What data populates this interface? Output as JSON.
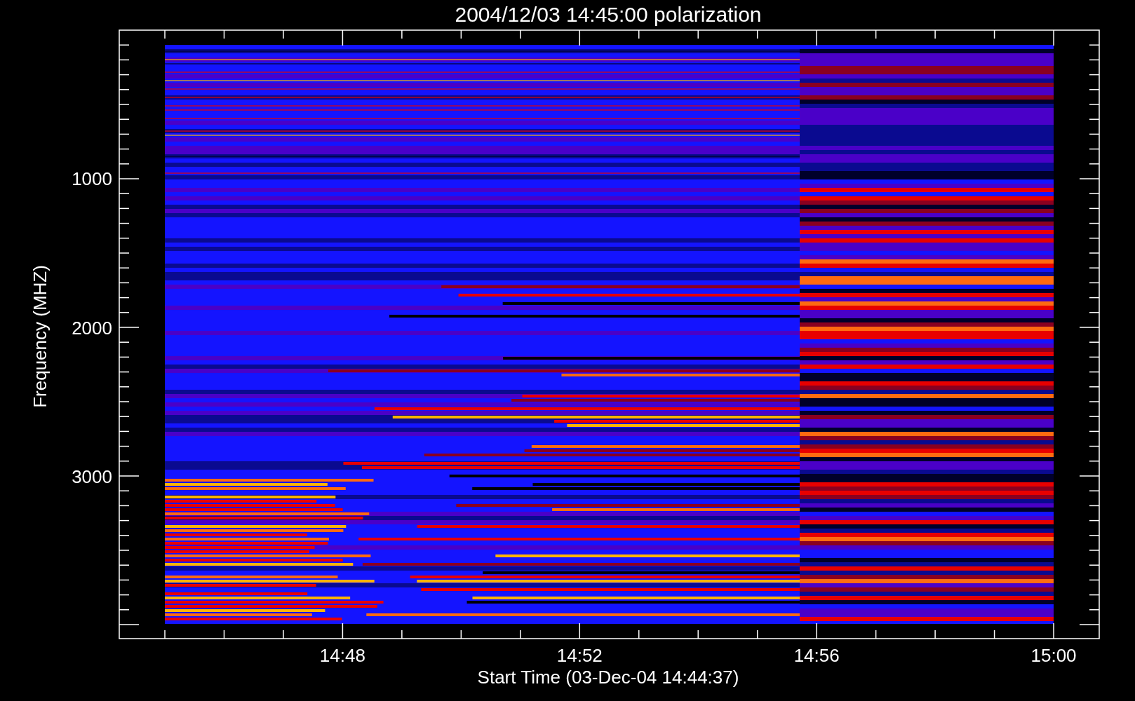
{
  "title": "2004/12/03 14:45:00 polarization",
  "y_axis": {
    "label": "Frequency (MHZ)",
    "ticks": [
      "1000",
      "2000",
      "3000"
    ]
  },
  "x_axis": {
    "label": "Start Time (03-Dec-04 14:44:37)",
    "ticks": [
      "14:48",
      "14:52",
      "14:56",
      "15:00"
    ]
  }
}
